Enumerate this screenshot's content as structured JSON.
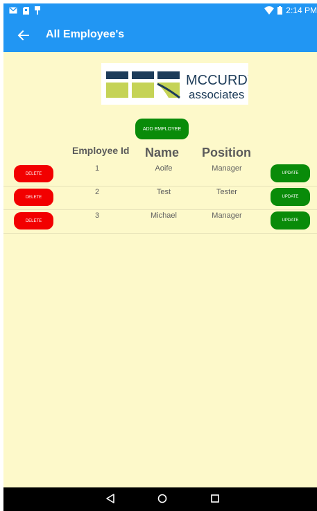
{
  "status_bar": {
    "time": "2:14 PM",
    "icons": [
      "mail-icon",
      "sd-card-icon",
      "usb-icon",
      "wifi-icon",
      "battery-icon"
    ]
  },
  "app_bar": {
    "title": "All Employee's",
    "back_icon": "arrow-left-icon"
  },
  "logo": {
    "line1": "MCCURDY",
    "line2": "associates",
    "colors": {
      "navy": "#1d3c59",
      "lime": "#c5d356",
      "text": "#1d3c59"
    }
  },
  "add_button": {
    "label": "ADD EMPLOYEE"
  },
  "table": {
    "headers": {
      "id": "Employee Id",
      "name": "Name",
      "position": "Position"
    },
    "rows": [
      {
        "id": "1",
        "name": "Aoife",
        "position": "Manager",
        "delete_label": "DELETE",
        "update_label": "UPDATE"
      },
      {
        "id": "2",
        "name": "Test",
        "position": "Tester",
        "delete_label": "DELETE",
        "update_label": "UPDATE"
      },
      {
        "id": "3",
        "name": "Michael",
        "position": "Manager",
        "delete_label": "DELETE",
        "update_label": "UPDATE"
      }
    ]
  },
  "nav_bar": {
    "icons": [
      "nav-back-icon",
      "nav-home-icon",
      "nav-recents-icon"
    ]
  },
  "colors": {
    "app_bar": "#2196f3",
    "background": "#fdf9ca",
    "add_button": "#098b09",
    "update_button": "#098b09",
    "delete_button": "#f20000",
    "nav_bar": "#000000"
  }
}
